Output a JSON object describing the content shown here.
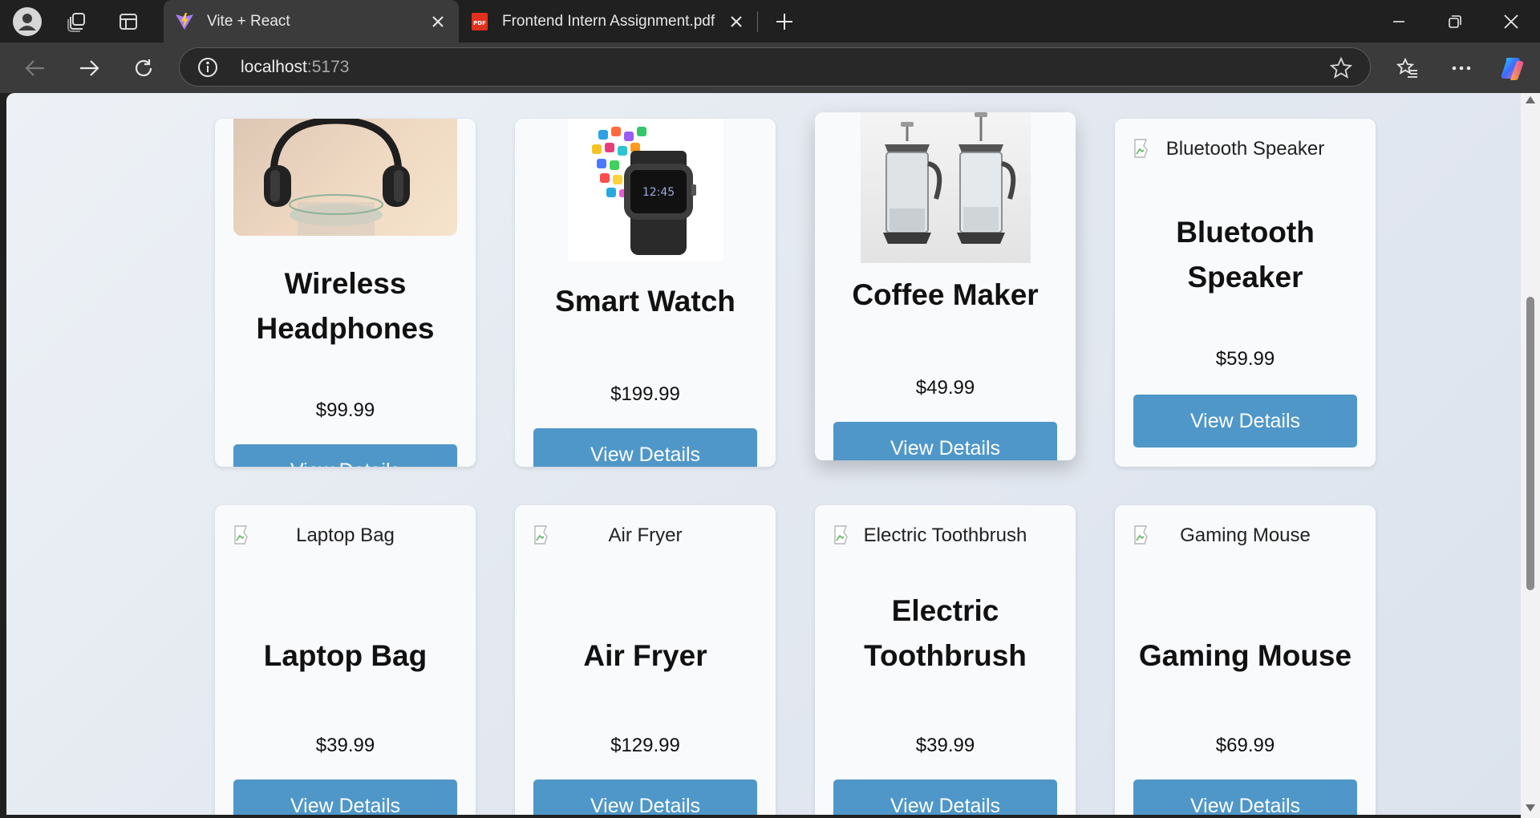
{
  "browser": {
    "tabs": [
      {
        "title": "Vite + React",
        "favicon": "vite-icon",
        "active": true
      },
      {
        "title": "Frontend Intern Assignment.pdf",
        "favicon": "pdf-icon",
        "active": false
      }
    ],
    "address": {
      "host": "localhost",
      "port": ":5173"
    },
    "icons": [
      "profile-icon",
      "workspaces-icon",
      "tab-actions-icon",
      "new-tab-icon",
      "back-icon",
      "forward-icon",
      "refresh-icon",
      "site-info-icon",
      "favorite-star-icon",
      "favorites-icon",
      "more-icon",
      "copilot-icon",
      "minimize-icon",
      "restore-icon",
      "close-window-icon"
    ]
  },
  "products": [
    {
      "name_line1": "Wireless",
      "name_line2": "Headphones",
      "price": "$99.99",
      "button": "View Details",
      "image": "headphones-image"
    },
    {
      "name_line1": "Smart Watch",
      "price": "$199.99",
      "button": "View Details",
      "image": "smartwatch-image"
    },
    {
      "name_line1": "Coffee Maker",
      "price": "$49.99",
      "button": "View Details",
      "image": "coffee-maker-image"
    },
    {
      "name_line1": "Bluetooth",
      "name_line2": "Speaker",
      "price": "$59.99",
      "button": "View Details",
      "alt": "Bluetooth Speaker"
    },
    {
      "name_line1": "Laptop Bag",
      "price": "$39.99",
      "button": "View Details",
      "alt": "Laptop Bag"
    },
    {
      "name_line1": "Air Fryer",
      "price": "$129.99",
      "button": "View Details",
      "alt": "Air Fryer"
    },
    {
      "name_line1": "Electric",
      "name_line2": "Toothbrush",
      "price": "$39.99",
      "button": "View Details",
      "alt": "Electric Toothbrush"
    },
    {
      "name_line1": "Gaming Mouse",
      "price": "$69.99",
      "button": "View Details",
      "alt": "Gaming Mouse"
    }
  ],
  "colors": {
    "button": "#4f97c9",
    "card": "#f9fafc",
    "page_bg": "#e8edf3",
    "chrome_dark": "#202020",
    "chrome_toolbar": "#3b3b3b"
  }
}
